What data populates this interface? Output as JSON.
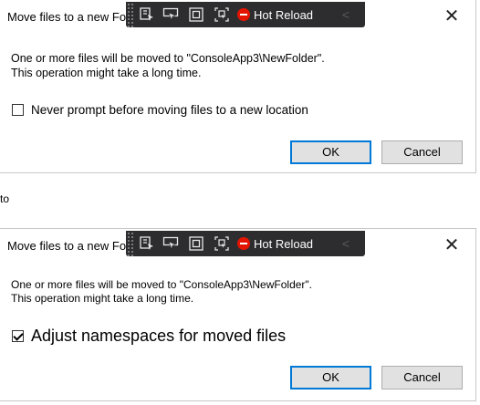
{
  "dialogs": [
    {
      "title": "Move files to a new Folder",
      "message_line1": "One or more files will be moved to \"ConsoleApp3\\NewFolder\".",
      "message_line2": "This operation might take a long time.",
      "checkbox_label": "Never prompt before moving files to a new location",
      "checkbox_checked": false,
      "ok_label": "OK",
      "cancel_label": "Cancel"
    },
    {
      "title": "Move files to a new Folder",
      "message_line1": "One or more files will be moved to \"ConsoleApp3\\NewFolder\".",
      "message_line2": "This operation might take a long time.",
      "checkbox_label": "Adjust namespaces for moved files",
      "checkbox_checked": true,
      "ok_label": "OK",
      "cancel_label": "Cancel"
    }
  ],
  "between_text": "to",
  "toolbar": {
    "hot_reload_label": "Hot Reload",
    "icons": [
      "select-element-icon",
      "pointer-icon",
      "display-layout-adorners-icon",
      "track-focus-icon",
      "hot-reload-icon",
      "collapse-chevron-icon"
    ],
    "background": "#2d2d30",
    "hot_reload_color": "#e51400"
  },
  "close_glyph": "✕",
  "colors": {
    "accent": "#0078d7",
    "button_bg": "#e1e1e1"
  }
}
